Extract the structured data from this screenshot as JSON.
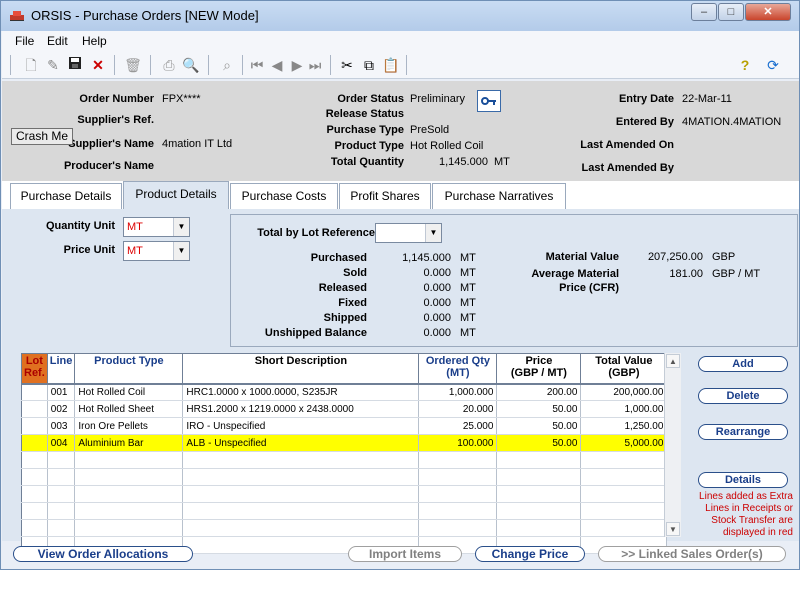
{
  "window": {
    "title": "ORSIS - Purchase Orders [NEW Mode]"
  },
  "menu": {
    "file": "File",
    "edit": "Edit",
    "help": "Help"
  },
  "header": {
    "order_number_label": "Order Number",
    "order_number": "FPX****",
    "supplier_ref_label": "Supplier's Ref.",
    "supplier_name_label": "Supplier's Name",
    "supplier_name": "4mation IT Ltd",
    "producer_name_label": "Producer's Name",
    "order_status_label": "Order Status",
    "order_status": "Preliminary",
    "release_status_label": "Release Status",
    "purchase_type_label": "Purchase Type",
    "purchase_type": "PreSold",
    "product_type_label": "Product Type",
    "product_type": "Hot Rolled Coil",
    "total_quantity_label": "Total Quantity",
    "total_quantity": "1,145.000",
    "total_quantity_unit": "MT",
    "entry_date_label": "Entry Date",
    "entry_date": "22-Mar-11",
    "entered_by_label": "Entered By",
    "entered_by": "4MATION.4MATION",
    "last_amended_on_label": "Last Amended On",
    "last_amended_by_label": "Last Amended By",
    "crash_button": "Crash Me"
  },
  "tabs": [
    "Purchase Details",
    "Product Details",
    "Purchase Costs",
    "Profit Shares",
    "Purchase Narratives"
  ],
  "product": {
    "quantity_unit_label": "Quantity Unit",
    "quantity_unit": "MT",
    "price_unit_label": "Price Unit",
    "price_unit": "MT",
    "total_by_lot_label": "Total by Lot Reference",
    "purchased_label": "Purchased",
    "purchased": "1,145.000",
    "purchased_unit": "MT",
    "sold_label": "Sold",
    "sold": "0.000",
    "sold_unit": "MT",
    "released_label": "Released",
    "released": "0.000",
    "released_unit": "MT",
    "fixed_label": "Fixed",
    "fixed": "0.000",
    "fixed_unit": "MT",
    "shipped_label": "Shipped",
    "shipped": "0.000",
    "shipped_unit": "MT",
    "unshipped_label": "Unshipped Balance",
    "unshipped": "0.000",
    "unshipped_unit": "MT",
    "material_value_label": "Material Value",
    "material_value": "207,250.00",
    "material_value_unit": "GBP",
    "avg_price_label_1": "Average Material",
    "avg_price_label_2": "Price (CFR)",
    "avg_price": "181.00",
    "avg_price_unit": "GBP / MT"
  },
  "grid": {
    "headers": {
      "lot1": "Lot",
      "lot2": "Ref.",
      "line": "Line",
      "product_type": "Product Type",
      "short_desc": "Short Description",
      "ordered_qty1": "Ordered Qty",
      "ordered_qty2": "(MT)",
      "price1": "Price",
      "price2": "(GBP / MT)",
      "total1": "Total Value",
      "total2": "(GBP)"
    },
    "rows": [
      {
        "lot": "",
        "line": "001",
        "product": "Hot Rolled Coil",
        "desc": "HRC1.0000 x 1000.0000, S235JR",
        "qty": "1,000.000",
        "price": "200.00",
        "total": "200,000.00"
      },
      {
        "lot": "",
        "line": "002",
        "product": "Hot Rolled Sheet",
        "desc": "HRS1.2000 x 1219.0000 x 2438.0000",
        "qty": "20.000",
        "price": "50.00",
        "total": "1,000.00"
      },
      {
        "lot": "",
        "line": "003",
        "product": "Iron Ore Pellets",
        "desc": "IRO - Unspecified",
        "qty": "25.000",
        "price": "50.00",
        "total": "1,250.00"
      },
      {
        "lot": "",
        "line": "004",
        "product": "Aluminium Bar",
        "desc": "ALB - Unspecified",
        "qty": "100.000",
        "price": "50.00",
        "total": "5,000.00"
      }
    ]
  },
  "side_buttons": {
    "add": "Add",
    "delete": "Delete",
    "rearrange": "Rearrange",
    "details": "Details"
  },
  "note": "Lines added as Extra Lines in Receipts or Stock Transfer are displayed in red",
  "bottom_buttons": {
    "view_alloc": "View Order Allocations",
    "import": "Import Items",
    "change_price": "Change Price",
    "linked": ">> Linked Sales Order(s)"
  },
  "colors": {
    "highlight_row": "#ffff00",
    "accent": "#1a3e8a",
    "lot_header": "#e07020"
  }
}
